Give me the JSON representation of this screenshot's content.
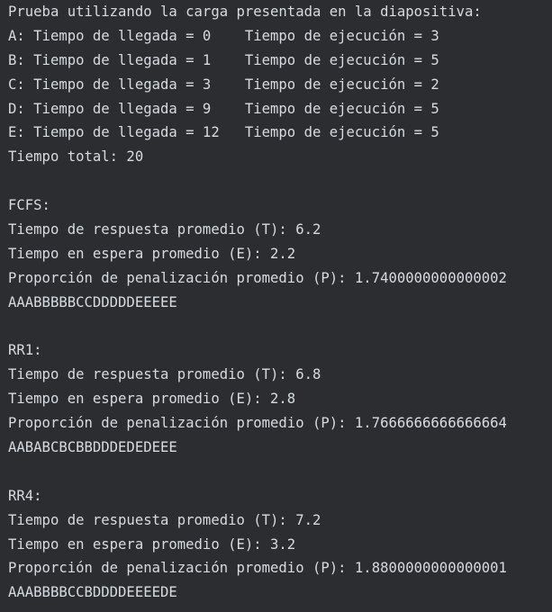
{
  "console": {
    "intro": "Prueba utilizando la carga presentada en la diapositiva:",
    "processes": [
      "A: Tiempo de llegada = 0    Tiempo de ejecución = 3",
      "B: Tiempo de llegada = 1    Tiempo de ejecución = 5",
      "C: Tiempo de llegada = 3    Tiempo de ejecución = 2",
      "D: Tiempo de llegada = 9    Tiempo de ejecución = 5",
      "E: Tiempo de llegada = 12   Tiempo de ejecución = 5"
    ],
    "total": "Tiempo total: 20",
    "fcfs": {
      "header": "FCFS:",
      "t": "Tiempo de respuesta promedio (T): 6.2",
      "e": "Tiempo en espera promedio (E): 2.2",
      "p": "Proporción de penalización promedio (P): 1.7400000000000002",
      "seq": "AAABBBBBCCDDDDDEEEEE"
    },
    "rr1": {
      "header": "RR1:",
      "t": "Tiempo de respuesta promedio (T): 6.8",
      "e": "Tiempo en espera promedio (E): 2.8",
      "p": "Proporción de penalización promedio (P): 1.7666666666666664",
      "seq": "AABABCBCBBDDDEDEDEEE"
    },
    "rr4": {
      "header": "RR4:",
      "t": "Tiempo de respuesta promedio (T): 7.2",
      "e": "Tiempo en espera promedio (E): 3.2",
      "p": "Proporción de penalización promedio (P): 1.8800000000000001",
      "seq": "AAABBBBCCBDDDDEEEEDE"
    }
  }
}
